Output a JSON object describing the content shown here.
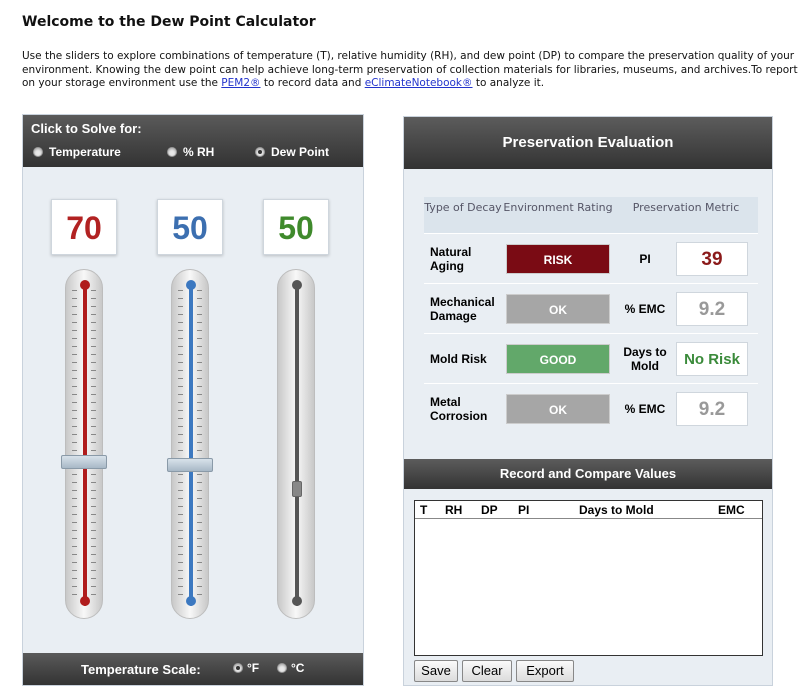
{
  "page": {
    "title": "Welcome to the Dew Point Calculator",
    "intro_text": "Use the sliders to explore combinations of temperature (T), relative humidity (RH), and dew point (DP) to compare the preservation quality of your environment. Knowing the dew point can help achieve long-term preservation of collection materials for libraries, museums, and archives.To report on your storage environment use the ",
    "link_pem2": "PEM2®",
    "intro_mid": " to record data and ",
    "link_eclimate": "eClimateNotebook®",
    "intro_end": " to analyze it."
  },
  "solve": {
    "title": "Click to Solve for:",
    "options": [
      "Temperature",
      "% RH",
      "Dew Point"
    ],
    "selected": "Dew Point"
  },
  "sliders": {
    "temperature": {
      "value": "70",
      "color": "#b22222",
      "level": 0.55
    },
    "rh": {
      "value": "50",
      "color": "#3c6fb0",
      "level": 0.56
    },
    "dew_point": {
      "value": "50",
      "color": "#3f8a2c",
      "level": 0.63
    }
  },
  "temperature_scale": {
    "label": "Temperature Scale:",
    "options": [
      "°F",
      "°C"
    ],
    "selected": "°F"
  },
  "evaluation": {
    "title": "Preservation Evaluation",
    "headers": {
      "type": "Type of Decay",
      "rating": "Environment Rating",
      "metric": "Preservation Metric"
    },
    "rows": [
      {
        "type": "Natural Aging",
        "rating": "RISK",
        "rating_color": "#7a0b14",
        "metric_label": "PI",
        "metric_value": "39",
        "metric_color": "#8b1a1a"
      },
      {
        "type": "Mechanical Damage",
        "rating": "OK",
        "rating_color": "#a6a6a6",
        "metric_label": "% EMC",
        "metric_value": "9.2",
        "metric_color": "#999999"
      },
      {
        "type": "Mold Risk",
        "rating": "GOOD",
        "rating_color": "#62a86a",
        "metric_label": "Days to Mold",
        "metric_value": "No Risk",
        "metric_color": "#3a8a3a"
      },
      {
        "type": "Metal Corrosion",
        "rating": "OK",
        "rating_color": "#a6a6a6",
        "metric_label": "% EMC",
        "metric_value": "9.2",
        "metric_color": "#999999"
      }
    ]
  },
  "record": {
    "title": "Record and Compare Values",
    "columns": [
      "T",
      "RH",
      "DP",
      "PI",
      "Days to Mold",
      "EMC"
    ],
    "rows": [],
    "buttons": {
      "save": "Save",
      "clear": "Clear",
      "export": "Export"
    }
  }
}
